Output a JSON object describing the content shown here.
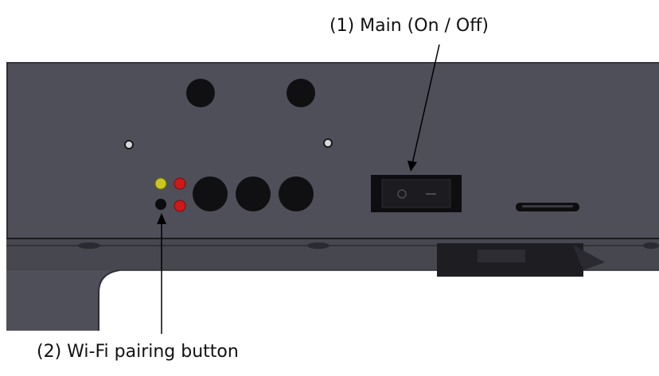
{
  "callouts": {
    "main_switch": "(1) Main (On / Off)",
    "wifi_button": "(2) Wi-Fi pairing button"
  },
  "colors": {
    "panel": "#4f4f5a",
    "panel_lower": "#43434c",
    "hole": "#101012",
    "led_yellow": "#c8c81e",
    "led_red": "#d01818",
    "background": "#ffffff"
  }
}
